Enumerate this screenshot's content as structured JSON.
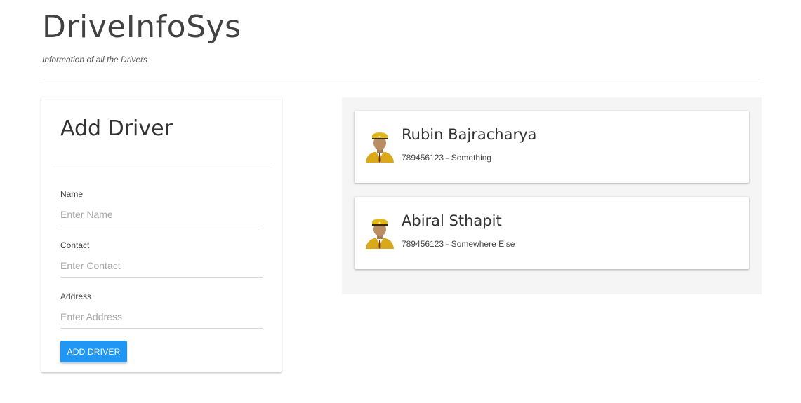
{
  "header": {
    "title": "DriveInfoSys",
    "subtitle": "Information of all the Drivers"
  },
  "form": {
    "title": "Add Driver",
    "fields": [
      {
        "label": "Name",
        "placeholder": "Enter Name",
        "value": ""
      },
      {
        "label": "Contact",
        "placeholder": "Enter Contact",
        "value": ""
      },
      {
        "label": "Address",
        "placeholder": "Enter Address",
        "value": ""
      }
    ],
    "submit_label": "ADD DRIVER"
  },
  "drivers": [
    {
      "name": "Rubin Bajracharya",
      "detail": "789456123 - Something",
      "avatar_icon": "driver-avatar-icon"
    },
    {
      "name": "Abiral Sthapit",
      "detail": "789456123 - Somewhere Else",
      "avatar_icon": "driver-avatar-icon"
    }
  ],
  "colors": {
    "accent": "#2196f3",
    "panel_bg": "#f5f5f5",
    "cap": "#e2b81d",
    "uniform": "#d9a91a",
    "skin": "#b98e63"
  }
}
